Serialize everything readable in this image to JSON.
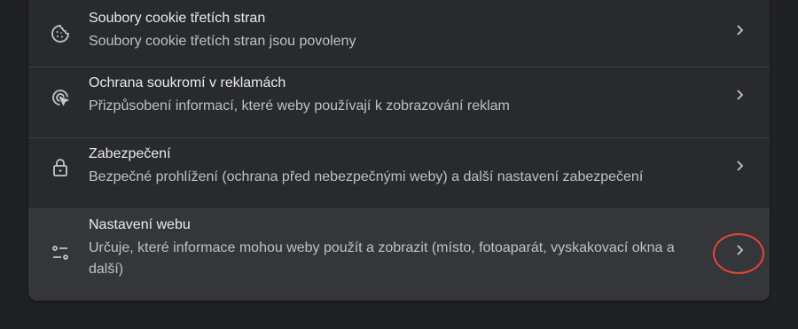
{
  "rows": [
    {
      "icon": "cookie-icon",
      "title": "Soubory cookie třetích stran",
      "subtitle": "Soubory cookie třetích stran jsou povoleny"
    },
    {
      "icon": "ad-privacy-icon",
      "title": "Ochrana soukromí v reklamách",
      "subtitle": "Přizpůsobení informací, které weby používají k zobrazování reklam"
    },
    {
      "icon": "lock-icon",
      "title": "Zabezpečení",
      "subtitle": "Bezpečné prohlížení (ochrana před nebezpečnými weby) a další nastavení zabezpečení"
    },
    {
      "icon": "site-settings-icon",
      "title": "Nastavení webu",
      "subtitle": "Určuje, které informace mohou weby použít a zobrazit (místo, fotoaparát, vyskakovací okna a další)"
    }
  ],
  "colors": {
    "background": "#202124",
    "card": "#292a2d",
    "hover_row": "#35363a",
    "title_text": "#e8eaed",
    "subtitle_text": "#bdc1c6",
    "icon": "#c4c7c5",
    "annotation_ring": "#e5453a"
  }
}
